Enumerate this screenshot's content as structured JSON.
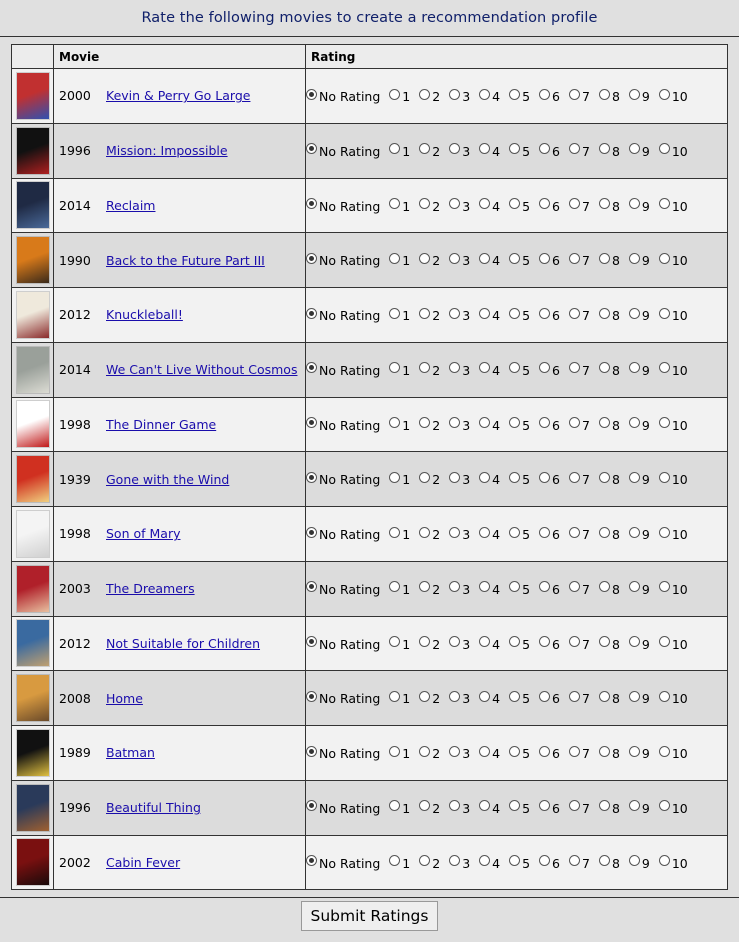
{
  "header": {
    "title": "Rate the following movies to create a recommendation profile"
  },
  "table": {
    "headers": {
      "poster": "",
      "movie": "Movie",
      "rating": "Rating"
    }
  },
  "rating_options": [
    "No Rating",
    "1",
    "2",
    "3",
    "4",
    "5",
    "6",
    "7",
    "8",
    "9",
    "10"
  ],
  "selected_option": "No Rating",
  "movies": [
    {
      "year": "2000",
      "title": "Kevin & Perry Go Large",
      "poster_colors": [
        "#c13030",
        "#3050b0"
      ]
    },
    {
      "year": "1996",
      "title": "Mission: Impossible",
      "poster_colors": [
        "#111111",
        "#b02020"
      ]
    },
    {
      "year": "2014",
      "title": "Reclaim",
      "poster_colors": [
        "#1f2a44",
        "#4a6a9a"
      ]
    },
    {
      "year": "1990",
      "title": "Back to the Future Part III",
      "poster_colors": [
        "#d87a1a",
        "#3a2a1a"
      ]
    },
    {
      "year": "2012",
      "title": "Knuckleball!",
      "poster_colors": [
        "#efe9dc",
        "#8a2a2a"
      ]
    },
    {
      "year": "2014",
      "title": "We Can't Live Without Cosmos",
      "poster_colors": [
        "#9aa09a",
        "#dcdcd4"
      ]
    },
    {
      "year": "1998",
      "title": "The Dinner Game",
      "poster_colors": [
        "#ffffff",
        "#c01818"
      ]
    },
    {
      "year": "1939",
      "title": "Gone with the Wind",
      "poster_colors": [
        "#d03020",
        "#f0d080"
      ]
    },
    {
      "year": "1998",
      "title": "Son of Mary",
      "poster_colors": [
        "#f4f4f4",
        "#d0d0d0"
      ]
    },
    {
      "year": "2003",
      "title": "The Dreamers",
      "poster_colors": [
        "#b0202a",
        "#e8c0a0"
      ]
    },
    {
      "year": "2012",
      "title": "Not Suitable for Children",
      "poster_colors": [
        "#3a6aa0",
        "#c0a070"
      ]
    },
    {
      "year": "2008",
      "title": "Home",
      "poster_colors": [
        "#d89a40",
        "#6a4a2a"
      ]
    },
    {
      "year": "1989",
      "title": "Batman",
      "poster_colors": [
        "#111111",
        "#e0c040"
      ]
    },
    {
      "year": "1996",
      "title": "Beautiful Thing",
      "poster_colors": [
        "#2a3a5a",
        "#a06030"
      ]
    },
    {
      "year": "2002",
      "title": "Cabin Fever",
      "poster_colors": [
        "#7a1010",
        "#1a0a0a"
      ]
    }
  ],
  "footer": {
    "submit_label": "Submit Ratings"
  }
}
